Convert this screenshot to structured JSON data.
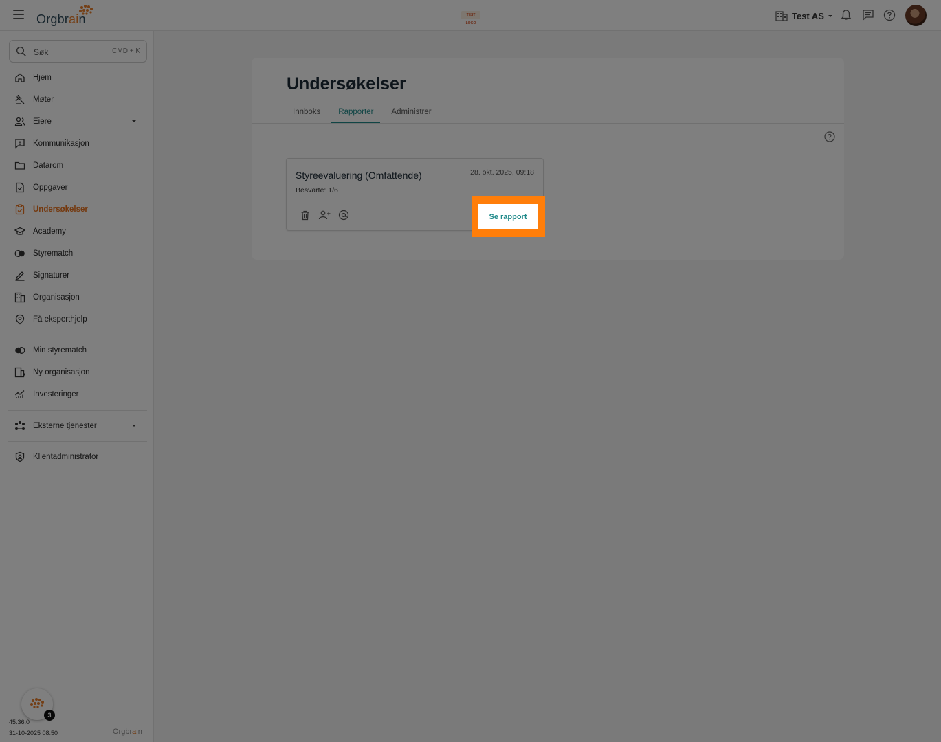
{
  "topbar": {
    "logo_text_pre": "Orgbr",
    "logo_text_ai": "ai",
    "logo_text_post": "n",
    "center_logo": "TEST LOGO",
    "org_name": "Test AS"
  },
  "sidebar": {
    "search_label": "Søk",
    "search_shortcut": "CMD + K",
    "items": [
      {
        "label": "Hjem"
      },
      {
        "label": "Møter"
      },
      {
        "label": "Eiere"
      },
      {
        "label": "Kommunikasjon"
      },
      {
        "label": "Datarom"
      },
      {
        "label": "Oppgaver"
      },
      {
        "label": "Undersøkelser"
      },
      {
        "label": "Academy"
      },
      {
        "label": "Styrematch"
      },
      {
        "label": "Signaturer"
      },
      {
        "label": "Organisasjon"
      },
      {
        "label": "Få eksperthjelp"
      },
      {
        "label": "Min styrematch"
      },
      {
        "label": "Ny organisasjon"
      },
      {
        "label": "Investeringer"
      },
      {
        "label": "Eksterne tjenester"
      },
      {
        "label": "Klientadministrator"
      }
    ],
    "chat_badge": "3",
    "version": "45.36.0",
    "build_date": "31-10-2025 08:50"
  },
  "main": {
    "title": "Undersøkelser",
    "tabs": [
      {
        "label": "Innboks"
      },
      {
        "label": "Rapporter"
      },
      {
        "label": "Administrer"
      }
    ],
    "active_tab": "Rapporter",
    "card": {
      "title": "Styreevaluering (Omfattende)",
      "date": "28. okt. 2025, 09:18",
      "answered": "Besvarte: 1/6",
      "button_label": "Se rapport"
    }
  },
  "colors": {
    "accent_teal": "#1f8a8a",
    "active_orange": "#e8731f",
    "highlight_orange": "#ff7e0a"
  }
}
